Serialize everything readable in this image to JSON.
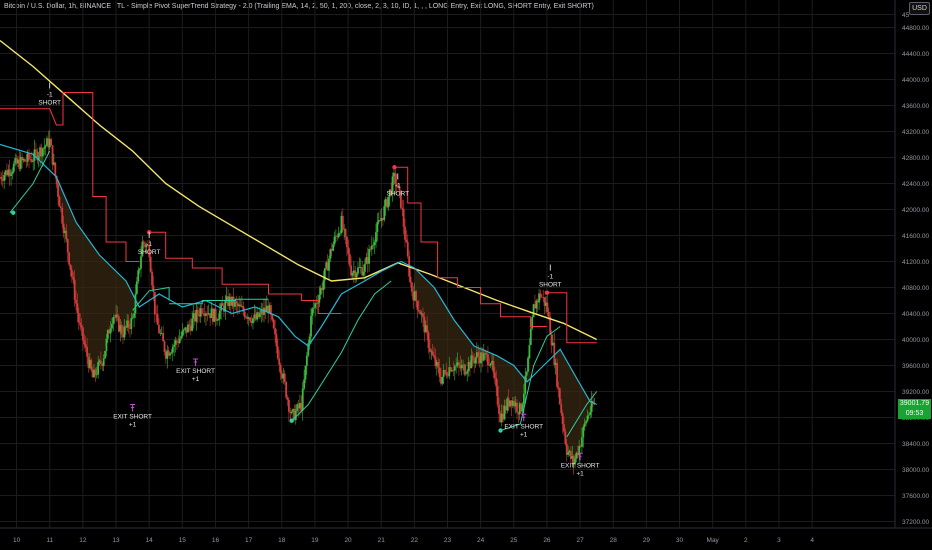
{
  "header": {
    "symbol": "Bitcoin / U.S. Dollar, 1h, BINANCE",
    "indicator": "TL - Simple Pivot SuperTrend Strategy - 2.0 (Trailing EMA, 14, 2, 50, 1, 200, close, 2, 3, 10, ID, 1, , , LONG Entry, Exit LONG, SHORT Entry, Exit SHORT)"
  },
  "currency_badge": "USD",
  "price_tag": {
    "price": "39001.79",
    "countdown": "09:53"
  },
  "colors": {
    "background": "#000000",
    "candle_up": "#3dbb3d",
    "candle_down": "#d63c3c",
    "supertrend_down": "#f23645",
    "supertrend_up": "#2bd1a0",
    "trailing_ema": "#27b5d4",
    "ema_200": "#f5e56b",
    "signal_short": "#ffffff",
    "signal_exit": "#d046e0",
    "grid": "#1c1c1c"
  },
  "chart_data": {
    "type": "line",
    "y_axis_ticks": [
      45000,
      44800,
      44400,
      44000,
      43600,
      43200,
      42800,
      42400,
      42000,
      41600,
      41200,
      40800,
      40400,
      40000,
      39600,
      39200,
      38800,
      38400,
      38000,
      37600,
      37200
    ],
    "y_tick_labels": [
      "45",
      "44800.00",
      "44400.00",
      "44000.00",
      "43600.00",
      "43200.00",
      "42800.00",
      "42400.00",
      "42000.00",
      "41600.00",
      "41200.00",
      "40800.00",
      "40400.00",
      "40000.00",
      "39600.00",
      "39200.00",
      "38800.00",
      "38400.00",
      "38000.00",
      "37600.00",
      "37200.00"
    ],
    "ylim": [
      37100,
      45100
    ],
    "x_tick_labels": [
      "10",
      "11",
      "12",
      "13",
      "14",
      "15",
      "16",
      "17",
      "18",
      "19",
      "20",
      "21",
      "22",
      "23",
      "24",
      "25",
      "26",
      "27",
      "28",
      "29",
      "30",
      "May",
      "2",
      "3",
      "4"
    ],
    "xlim": [
      9.5,
      36.5
    ],
    "series": [
      {
        "key": "ema_200",
        "points": [
          [
            9.5,
            44600
          ],
          [
            10.5,
            44200
          ],
          [
            11.5,
            43750
          ],
          [
            12.5,
            43300
          ],
          [
            13.5,
            42900
          ],
          [
            14.5,
            42400
          ],
          [
            15.5,
            42050
          ],
          [
            16.5,
            41750
          ],
          [
            17.5,
            41450
          ],
          [
            18.5,
            41150
          ],
          [
            19.5,
            40900
          ],
          [
            20.5,
            40950
          ],
          [
            21.5,
            41180
          ],
          [
            22.5,
            41000
          ],
          [
            23.5,
            40800
          ],
          [
            24.5,
            40600
          ],
          [
            25.5,
            40420
          ],
          [
            26.5,
            40250
          ],
          [
            27.5,
            40000
          ]
        ]
      },
      {
        "key": "trailing_ema",
        "points": [
          [
            9.5,
            43000
          ],
          [
            10.5,
            42850
          ],
          [
            11.2,
            42500
          ],
          [
            11.8,
            41800
          ],
          [
            12.5,
            41300
          ],
          [
            13.3,
            40900
          ],
          [
            13.7,
            40500
          ],
          [
            14.3,
            40700
          ],
          [
            15.0,
            40500
          ],
          [
            15.7,
            40600
          ],
          [
            16.5,
            40400
          ],
          [
            17.2,
            40500
          ],
          [
            17.9,
            40350
          ],
          [
            18.4,
            40050
          ],
          [
            18.8,
            39900
          ],
          [
            19.2,
            40200
          ],
          [
            19.8,
            40700
          ],
          [
            20.5,
            40900
          ],
          [
            21.0,
            41050
          ],
          [
            21.6,
            41200
          ],
          [
            22.0,
            41100
          ],
          [
            22.6,
            40800
          ],
          [
            23.2,
            40300
          ],
          [
            23.8,
            39900
          ],
          [
            24.5,
            39750
          ],
          [
            25.0,
            39600
          ],
          [
            25.4,
            39350
          ],
          [
            25.9,
            39600
          ],
          [
            26.4,
            39850
          ],
          [
            26.9,
            39400
          ],
          [
            27.3,
            39050
          ],
          [
            27.5,
            39000
          ]
        ]
      },
      {
        "key": "supertrend_down",
        "points": [
          [
            9.5,
            43550
          ],
          [
            11.0,
            43550
          ],
          [
            11.2,
            43300
          ],
          [
            11.4,
            43300
          ],
          [
            11.4,
            43800
          ],
          [
            12.3,
            43800
          ],
          [
            12.3,
            42200
          ],
          [
            12.7,
            42200
          ],
          [
            12.7,
            41500
          ],
          [
            13.3,
            41500
          ],
          [
            13.3,
            41200
          ],
          [
            13.7,
            41200
          ]
        ]
      },
      {
        "key": "supertrend_down",
        "points": [
          [
            14.0,
            41650
          ],
          [
            14.5,
            41650
          ],
          [
            14.5,
            41250
          ],
          [
            15.3,
            41250
          ],
          [
            15.3,
            41100
          ],
          [
            16.2,
            41100
          ],
          [
            16.2,
            40850
          ],
          [
            17.6,
            40850
          ],
          [
            17.6,
            40700
          ],
          [
            18.6,
            40700
          ],
          [
            18.6,
            40600
          ],
          [
            19.1,
            40600
          ],
          [
            19.1,
            40400
          ],
          [
            19.8,
            40400
          ]
        ]
      },
      {
        "key": "supertrend_down",
        "points": [
          [
            21.4,
            42650
          ],
          [
            21.8,
            42650
          ],
          [
            21.8,
            42100
          ],
          [
            22.2,
            42100
          ],
          [
            22.2,
            41500
          ],
          [
            22.7,
            41500
          ],
          [
            22.7,
            40950
          ],
          [
            23.3,
            40950
          ],
          [
            23.3,
            40800
          ],
          [
            24.0,
            40800
          ],
          [
            24.0,
            40550
          ],
          [
            24.6,
            40550
          ],
          [
            24.6,
            40350
          ],
          [
            25.5,
            40350
          ],
          [
            25.5,
            40200
          ],
          [
            26.0,
            40200
          ]
        ]
      },
      {
        "key": "supertrend_down",
        "points": [
          [
            26.0,
            40720
          ],
          [
            26.6,
            40720
          ],
          [
            26.6,
            39950
          ],
          [
            27.5,
            39950
          ]
        ]
      },
      {
        "key": "supertrend_up",
        "points": [
          [
            9.8,
            41950
          ],
          [
            10.5,
            42400
          ],
          [
            11.0,
            42900
          ]
        ]
      },
      {
        "key": "supertrend_up",
        "points": [
          [
            13.5,
            40450
          ],
          [
            14.0,
            40750
          ],
          [
            14.6,
            40800
          ],
          [
            14.6,
            40600
          ]
        ]
      },
      {
        "key": "supertrend_up",
        "points": [
          [
            14.6,
            40550
          ],
          [
            15.6,
            40550
          ],
          [
            15.6,
            40600
          ],
          [
            16.6,
            40600
          ],
          [
            16.6,
            40620
          ],
          [
            17.6,
            40620
          ]
        ]
      },
      {
        "key": "supertrend_up",
        "points": [
          [
            18.3,
            38750
          ],
          [
            18.8,
            39000
          ],
          [
            19.3,
            39400
          ],
          [
            19.8,
            39800
          ],
          [
            20.3,
            40300
          ],
          [
            20.8,
            40700
          ],
          [
            21.3,
            40900
          ]
        ]
      },
      {
        "key": "supertrend_up",
        "points": [
          [
            24.6,
            38600
          ],
          [
            25.2,
            38700
          ],
          [
            25.6,
            39600
          ],
          [
            26.0,
            40050
          ],
          [
            26.4,
            40200
          ]
        ]
      },
      {
        "key": "supertrend_up",
        "points": [
          [
            26.6,
            38500
          ],
          [
            27.2,
            39000
          ],
          [
            27.5,
            39200
          ]
        ]
      }
    ],
    "markers": [
      {
        "type": "dot",
        "series": "supertrend_up",
        "x": 9.9,
        "y": 41950
      },
      {
        "type": "dot",
        "series": "supertrend_down",
        "x": 14.0,
        "y": 41650
      },
      {
        "type": "dot",
        "series": "supertrend_up",
        "x": 18.3,
        "y": 38750
      },
      {
        "type": "dot",
        "series": "supertrend_down",
        "x": 21.4,
        "y": 42650
      },
      {
        "type": "dot",
        "series": "supertrend_up",
        "x": 24.6,
        "y": 38600
      },
      {
        "type": "dot",
        "series": "supertrend_down",
        "x": 26.0,
        "y": 40720
      }
    ],
    "signals": [
      {
        "kind": "short",
        "x": 11.0,
        "y": 43400,
        "labels": [
          "-1",
          "SHORT"
        ]
      },
      {
        "kind": "exit",
        "x": 13.5,
        "y": 39000,
        "labels": [
          "EXIT SHORT",
          "+1"
        ]
      },
      {
        "kind": "short",
        "x": 14.0,
        "y": 41100,
        "labels": [
          "-1",
          "SHORT"
        ]
      },
      {
        "kind": "exit",
        "x": 15.4,
        "y": 39700,
        "labels": [
          "EXIT SHORT",
          "+1"
        ]
      },
      {
        "kind": "short",
        "x": 21.5,
        "y": 42000,
        "labels": [
          "-1",
          "SHORT"
        ]
      },
      {
        "kind": "exit",
        "x": 25.3,
        "y": 38850,
        "labels": [
          "EXIT SHORT",
          "+1"
        ]
      },
      {
        "kind": "short",
        "x": 26.1,
        "y": 40600,
        "labels": [
          "-1",
          "SHORT"
        ]
      },
      {
        "kind": "exit",
        "x": 27.0,
        "y": 38250,
        "labels": [
          "EXIT SHORT",
          "+1"
        ]
      }
    ],
    "price_path": [
      [
        9.5,
        42500
      ],
      [
        10.0,
        42700
      ],
      [
        10.5,
        42800
      ],
      [
        11.0,
        43050
      ],
      [
        11.3,
        42100
      ],
      [
        11.6,
        41200
      ],
      [
        11.9,
        40200
      ],
      [
        12.3,
        39400
      ],
      [
        12.6,
        39700
      ],
      [
        12.9,
        40400
      ],
      [
        13.2,
        40100
      ],
      [
        13.5,
        40300
      ],
      [
        13.8,
        41500
      ],
      [
        14.0,
        41400
      ],
      [
        14.2,
        40300
      ],
      [
        14.5,
        39800
      ],
      [
        14.8,
        39950
      ],
      [
        15.2,
        40200
      ],
      [
        15.6,
        40500
      ],
      [
        16.0,
        40350
      ],
      [
        16.4,
        40600
      ],
      [
        16.8,
        40450
      ],
      [
        17.2,
        40300
      ],
      [
        17.6,
        40500
      ],
      [
        18.0,
        39500
      ],
      [
        18.3,
        38800
      ],
      [
        18.6,
        39000
      ],
      [
        18.9,
        40400
      ],
      [
        19.2,
        40800
      ],
      [
        19.5,
        41400
      ],
      [
        19.8,
        41800
      ],
      [
        20.1,
        41050
      ],
      [
        20.5,
        41100
      ],
      [
        20.8,
        41600
      ],
      [
        21.1,
        42000
      ],
      [
        21.4,
        42500
      ],
      [
        21.6,
        42100
      ],
      [
        21.9,
        40800
      ],
      [
        22.2,
        40400
      ],
      [
        22.5,
        39800
      ],
      [
        22.8,
        39400
      ],
      [
        23.1,
        39600
      ],
      [
        23.5,
        39550
      ],
      [
        23.9,
        39750
      ],
      [
        24.3,
        39700
      ],
      [
        24.6,
        38800
      ],
      [
        24.9,
        39100
      ],
      [
        25.2,
        38900
      ],
      [
        25.4,
        39500
      ],
      [
        25.6,
        40500
      ],
      [
        25.8,
        40700
      ],
      [
        26.0,
        40500
      ],
      [
        26.2,
        39800
      ],
      [
        26.4,
        39000
      ],
      [
        26.6,
        38300
      ],
      [
        26.8,
        38100
      ],
      [
        27.0,
        38400
      ],
      [
        27.2,
        38800
      ],
      [
        27.4,
        39000
      ]
    ]
  }
}
